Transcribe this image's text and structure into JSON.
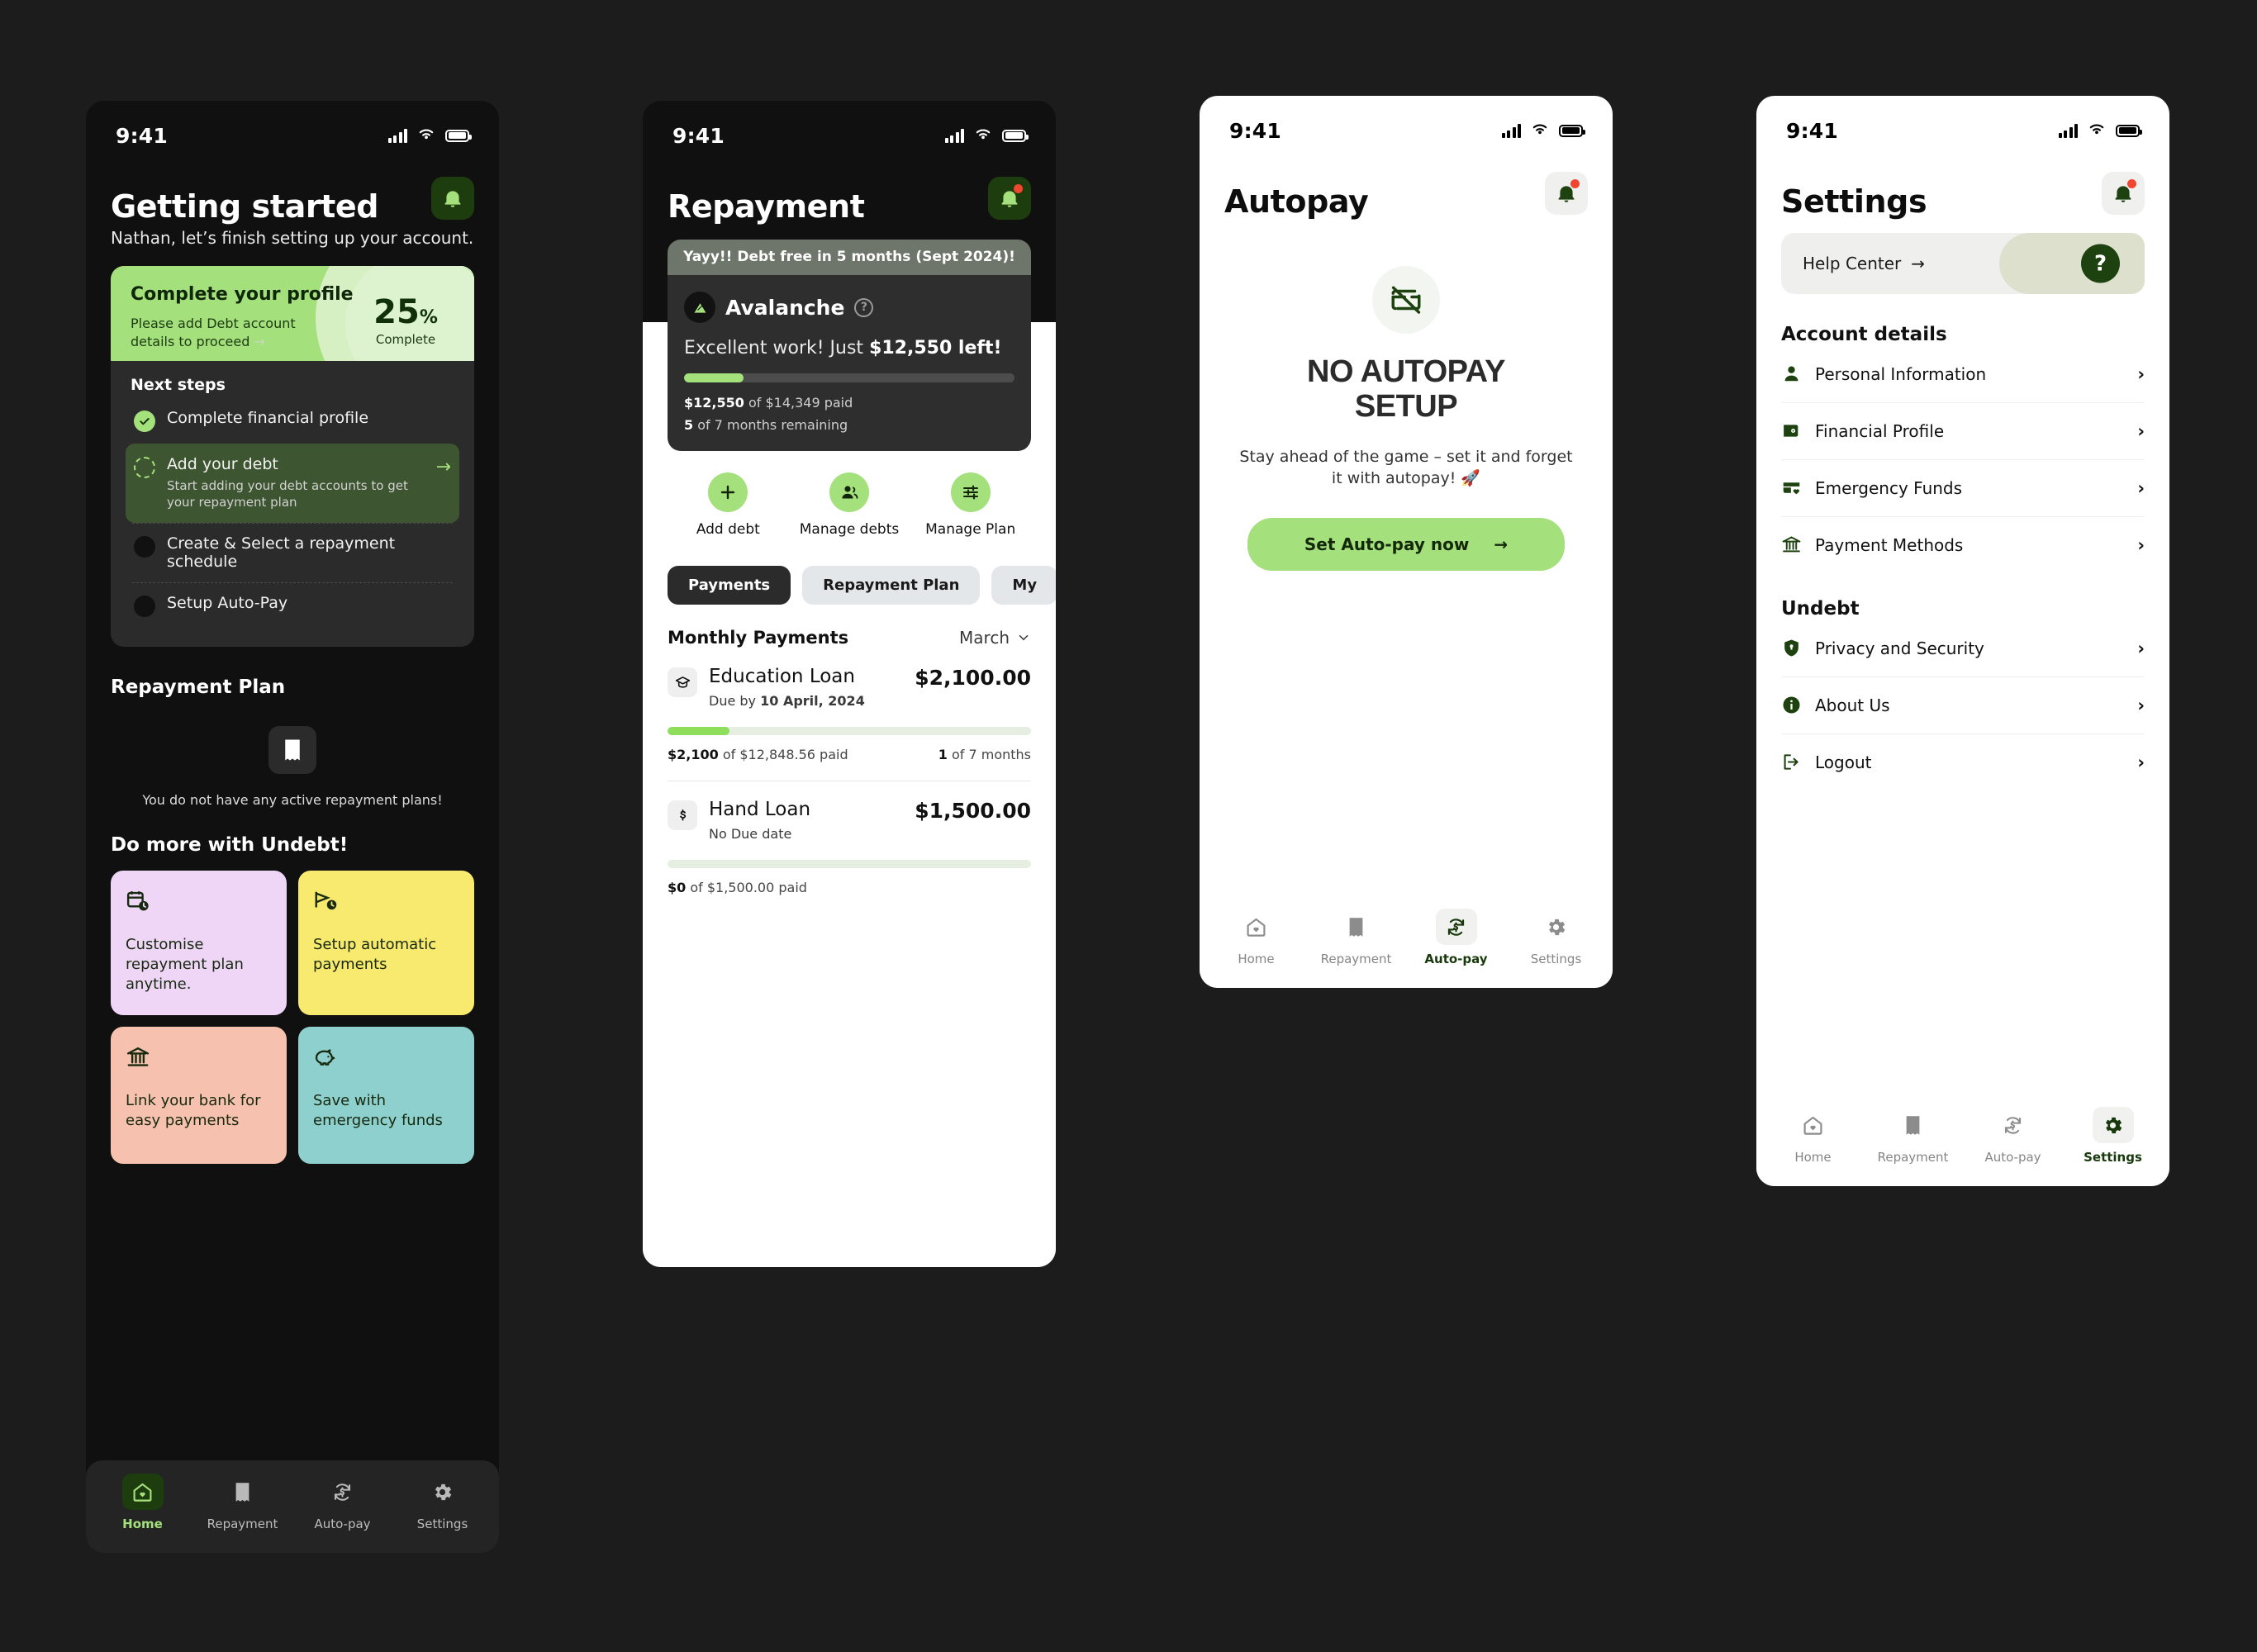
{
  "status_bar": {
    "time": "9:41"
  },
  "screen1": {
    "title": "Getting started",
    "subtitle": "Nathan, let’s finish setting up your account.",
    "profile_card": {
      "title": "Complete your profile",
      "desc": "Please add Debt account details to proceed",
      "percent": "25",
      "percent_symbol": "%",
      "complete_label": "Complete"
    },
    "next_steps_title": "Next steps",
    "steps": [
      {
        "label": "Complete financial profile",
        "state": "done",
        "desc": ""
      },
      {
        "label": "Add your debt",
        "state": "active",
        "desc": "Start adding your debt accounts to get your repayment plan"
      },
      {
        "label": "Create & Select a repayment schedule",
        "state": "todo",
        "desc": ""
      },
      {
        "label": "Setup Auto-Pay",
        "state": "todo",
        "desc": ""
      }
    ],
    "repayment_plan_title": "Repayment Plan",
    "empty_text": "You do not have any active repayment plans!",
    "do_more_title": "Do more with Undebt!",
    "tiles": [
      {
        "text": "Customise repayment plan anytime.",
        "color": "#efd6f7",
        "icon": "calendar-clock-icon"
      },
      {
        "text": "Setup automatic payments",
        "color": "#f8e96f",
        "icon": "megaphone-clock-icon"
      },
      {
        "text": "Link your bank for easy payments",
        "color": "#f6c1ae",
        "icon": "bank-icon"
      },
      {
        "text": "Save with emergency funds",
        "color": "#8ed0cd",
        "icon": "piggy-bank-icon"
      }
    ],
    "nav": [
      {
        "label": "Home",
        "icon": "home-heart-icon",
        "active": true
      },
      {
        "label": "Repayment",
        "icon": "receipt-icon",
        "active": false
      },
      {
        "label": "Auto-pay",
        "icon": "autopay-icon",
        "active": false
      },
      {
        "label": "Settings",
        "icon": "gear-icon",
        "active": false
      }
    ]
  },
  "screen2": {
    "title": "Repayment",
    "banner": "Yayy!! Debt free in 5 months (Sept 2024)!",
    "strategy": "Avalanche",
    "progress_line_prefix": "Excellent work! Just ",
    "progress_line_amount": "$12,550 left!",
    "progress_percent": 18,
    "paid_prefix": "$12,550",
    "paid_rest": " of $14,349 paid",
    "months_prefix": "5",
    "months_rest": " of 7 months remaining",
    "actions": [
      {
        "label": "Add debt",
        "icon": "plus-icon"
      },
      {
        "label": "Manage debts",
        "icon": "people-icon"
      },
      {
        "label": "Manage Plan",
        "icon": "sliders-icon"
      }
    ],
    "tabs": [
      {
        "label": "Payments",
        "active": true
      },
      {
        "label": "Repayment Plan",
        "active": false
      },
      {
        "label": "My",
        "active": false
      }
    ],
    "section_title": "Monthly Payments",
    "month": "March",
    "loans": [
      {
        "name": "Education Loan",
        "icon": "graduation-cap-icon",
        "amount": "$2,100.00",
        "due_prefix": "Due by ",
        "due_value": "10 April, 2024",
        "progress_percent": 17,
        "paid_bold": "$2,100",
        "paid_rest": " of $12,848.56 paid",
        "months_bold": "1",
        "months_rest": " of 7 months"
      },
      {
        "name": "Hand Loan",
        "icon": "dollar-icon",
        "amount": "$1,500.00",
        "due_prefix": "No Due date",
        "due_value": "",
        "progress_percent": 0,
        "paid_bold": "$0",
        "paid_rest": " of $1,500.00 paid",
        "months_bold": "",
        "months_rest": ""
      }
    ],
    "nav": [
      {
        "label": "Home",
        "icon": "home-heart-icon",
        "active": false
      },
      {
        "label": "Repayment",
        "icon": "receipt-icon",
        "active": true
      },
      {
        "label": "Auto-pay",
        "icon": "autopay-icon",
        "active": false
      },
      {
        "label": "Settings",
        "icon": "gear-icon",
        "active": false
      }
    ]
  },
  "screen3": {
    "title": "Autopay",
    "empty_icon": "card-off-icon",
    "headline_line1": "NO AUTOPAY",
    "headline_line2": "SETUP",
    "body": "Stay ahead of the game – set it and forget it with autopay! 🚀",
    "cta": "Set Auto-pay now",
    "nav": [
      {
        "label": "Home",
        "icon": "home-heart-icon",
        "active": false
      },
      {
        "label": "Repayment",
        "icon": "receipt-icon",
        "active": false
      },
      {
        "label": "Auto-pay",
        "icon": "autopay-icon",
        "active": true
      },
      {
        "label": "Settings",
        "icon": "gear-icon",
        "active": false
      }
    ]
  },
  "screen4": {
    "title": "Settings",
    "help_center": "Help Center",
    "help_icon": "question-mark-icon",
    "account_section": "Account details",
    "account_items": [
      {
        "label": "Personal Information",
        "icon": "person-icon"
      },
      {
        "label": "Financial Profile",
        "icon": "wallet-icon"
      },
      {
        "label": "Emergency Funds",
        "icon": "card-heart-icon"
      },
      {
        "label": "Payment Methods",
        "icon": "bank-icon"
      }
    ],
    "undebt_section": "Undebt",
    "undebt_items": [
      {
        "label": "Privacy and Security",
        "icon": "shield-lock-icon"
      },
      {
        "label": "About Us",
        "icon": "info-icon"
      },
      {
        "label": "Logout",
        "icon": "logout-icon"
      }
    ],
    "nav": [
      {
        "label": "Home",
        "icon": "home-heart-icon",
        "active": false
      },
      {
        "label": "Repayment",
        "icon": "receipt-icon",
        "active": false
      },
      {
        "label": "Auto-pay",
        "icon": "autopay-icon",
        "active": false
      },
      {
        "label": "Settings",
        "icon": "gear-icon",
        "active": true
      }
    ]
  },
  "colors": {
    "accent_green": "#a4e07b",
    "dark_green": "#1d4210",
    "page_bg": "#1c1c1c",
    "dark_surface": "#2b2b2b"
  }
}
